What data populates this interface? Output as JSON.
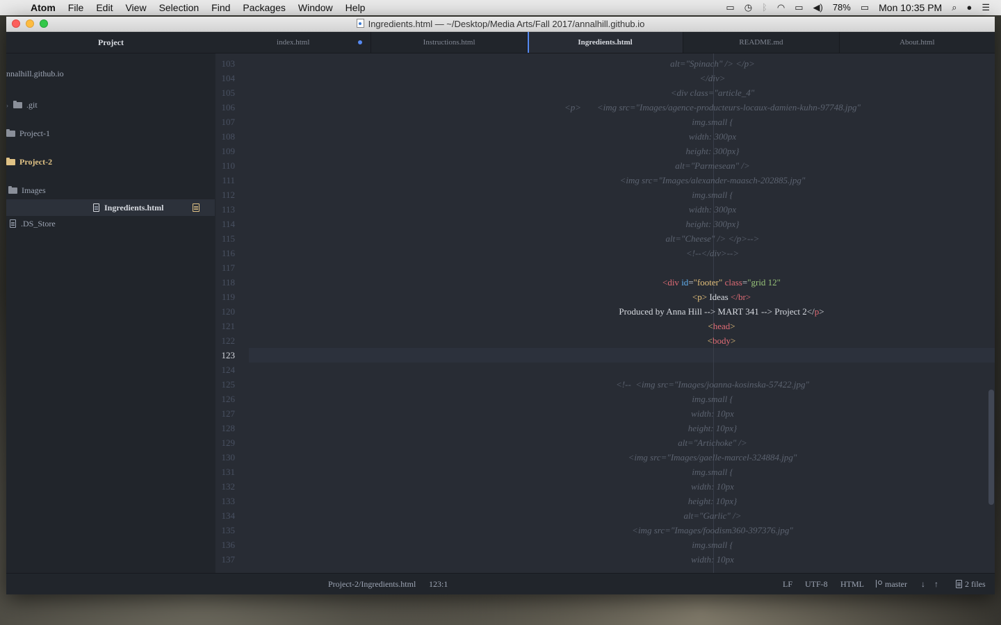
{
  "menubar": {
    "app_name": "Atom",
    "items": [
      "File",
      "Edit",
      "View",
      "Selection",
      "Find",
      "Packages",
      "Window",
      "Help"
    ],
    "battery": "78%",
    "clock": "Mon 10:35 PM"
  },
  "window": {
    "title": "Ingredients.html — ~/Desktop/Media Arts/Fall 2017/annalhill.github.io"
  },
  "sidebar": {
    "header": "Project",
    "root": "nnalhill.github.io",
    "items": [
      {
        "label": ".git",
        "type": "folder"
      },
      {
        "label": "Project-1",
        "type": "folder"
      },
      {
        "label": "Project-2",
        "type": "folder",
        "modified": true
      },
      {
        "label": "Images",
        "type": "folder"
      },
      {
        "label": "Ingredients.html",
        "type": "file",
        "selected": true
      },
      {
        "label": ".DS_Store",
        "type": "file"
      }
    ]
  },
  "tabs": [
    {
      "label": "index.html",
      "modified": true
    },
    {
      "label": "Instructions.html"
    },
    {
      "label": "Ingredients.html",
      "active": true
    },
    {
      "label": "README.md"
    },
    {
      "label": "About.html"
    }
  ],
  "editor": {
    "current_line": 123,
    "lines": [
      {
        "n": 103,
        "c": "alt=\"Spinach\" /> </p>"
      },
      {
        "n": 104,
        "c": "</div>"
      },
      {
        "n": 105,
        "c": "<div class=\"article_4\""
      },
      {
        "n": 106,
        "c": "<p>       <img src=\"Images/agence-producteurs-locaux-damien-kuhn-97748.jpg\""
      },
      {
        "n": 107,
        "c": "img.small {"
      },
      {
        "n": 108,
        "c": "width: 300px"
      },
      {
        "n": 109,
        "c": "height: 300px}"
      },
      {
        "n": 110,
        "c": "alt=\"Parmesean\" />"
      },
      {
        "n": 111,
        "c": "<img src=\"Images/alexander-maasch-202885.jpg\""
      },
      {
        "n": 112,
        "c": "img.small {"
      },
      {
        "n": 113,
        "c": "width: 300px"
      },
      {
        "n": 114,
        "c": "height: 300px}"
      },
      {
        "n": 115,
        "c": "alt=\"Cheese\" /> </p>-->"
      },
      {
        "n": 116,
        "c": "<!--</div>-->"
      },
      {
        "n": 117,
        "c": ""
      },
      {
        "n": 118,
        "c": ""
      },
      {
        "n": 119,
        "c": "Produced by Anna Hill --> MART 341 --> Project 2"
      },
      {
        "n": 120,
        "c": ""
      },
      {
        "n": 121,
        "c": ""
      },
      {
        "n": 122,
        "c": ""
      },
      {
        "n": 123,
        "c": ""
      },
      {
        "n": 124,
        "c": ""
      },
      {
        "n": 125,
        "c": "<!--  <img src=\"Images/joanna-kosinska-57422.jpg\""
      },
      {
        "n": 126,
        "c": "img.small {"
      },
      {
        "n": 127,
        "c": "width: 10px"
      },
      {
        "n": 128,
        "c": "height: 10px}"
      },
      {
        "n": 129,
        "c": "alt=\"Artichoke\" />"
      },
      {
        "n": 130,
        "c": "<img src=\"Images/gaelle-marcel-324884.jpg\""
      },
      {
        "n": 131,
        "c": "img.small {"
      },
      {
        "n": 132,
        "c": "width: 10px"
      },
      {
        "n": 133,
        "c": "height: 10px}"
      },
      {
        "n": 134,
        "c": "alt=\"Garlic\" />"
      },
      {
        "n": 135,
        "c": "<img src=\"Images/foodism360-397376.jpg\""
      },
      {
        "n": 136,
        "c": "img.small {"
      },
      {
        "n": 137,
        "c": "width: 10px"
      }
    ],
    "footer_code": {
      "open_div": "<div",
      "id_attr": "id",
      "eq": "=",
      "id_val": "\"footer\"",
      "class_attr": "class",
      "class_val": "\"grid 12\"",
      "p_open": "<p>",
      "ideas": " Ideas ",
      "br": "</br>",
      "p_close_lt": "</",
      "p_close_name": "p",
      "p_close_gt": ">",
      "head_lt": "<",
      "head_name": "head",
      "head_gt": ">",
      "body_lt": "<",
      "body_name": "body",
      "body_gt": ">"
    }
  },
  "statusbar": {
    "path": "Project-2/Ingredients.html",
    "cursor": "123:1",
    "line_ending": "LF",
    "encoding": "UTF-8",
    "grammar": "HTML",
    "branch": "master",
    "fetch_down": "↓",
    "fetch_up": "↑",
    "changed_files": "2 files"
  }
}
